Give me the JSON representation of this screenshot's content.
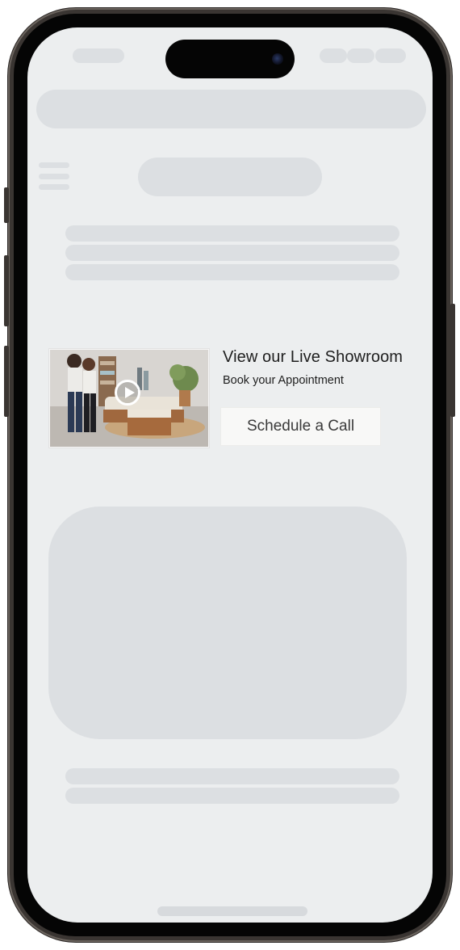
{
  "showroom": {
    "title": "View our Live Showroom",
    "subtitle": "Book your Appointment",
    "cta_label": "Schedule a Call",
    "thumbnail_icon": "play-icon"
  },
  "colors": {
    "screen_bg": "#eceeef",
    "skeleton": "#dcdfe2",
    "text": "#1e1e1e",
    "button_bg": "#f8f8f7"
  }
}
